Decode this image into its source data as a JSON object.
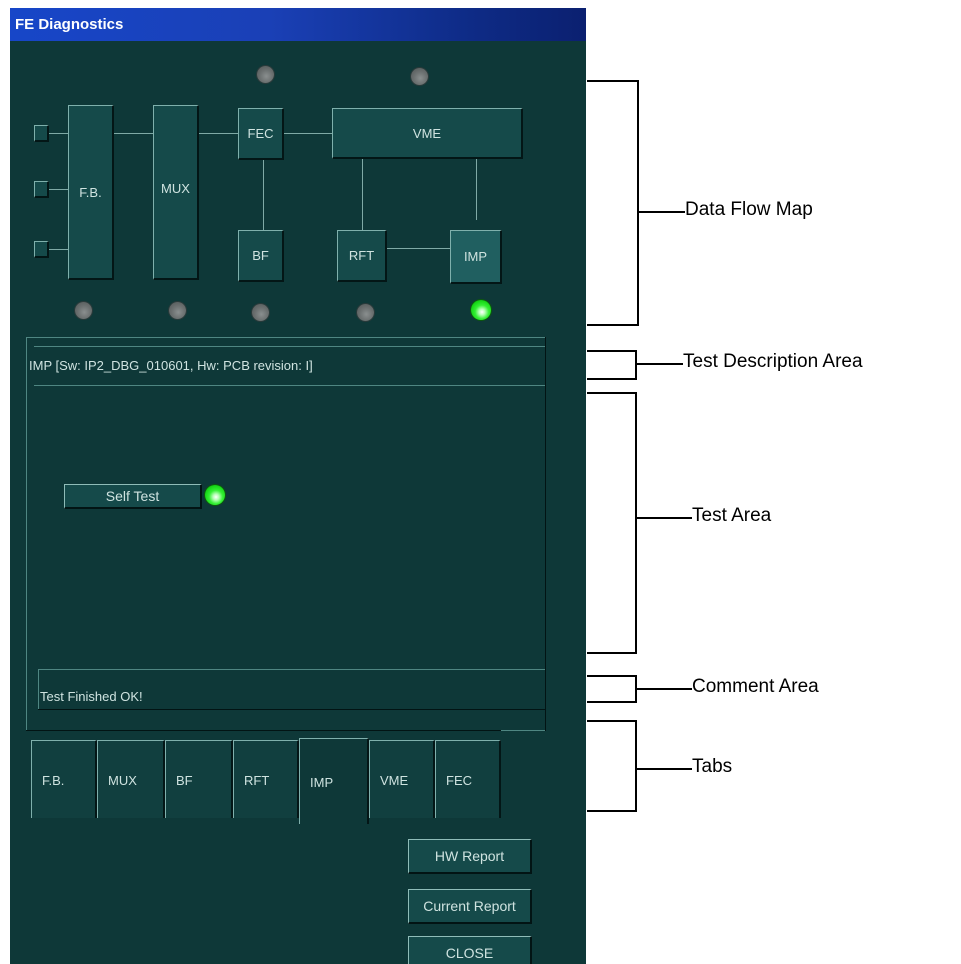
{
  "window": {
    "title": "FE Diagnostics"
  },
  "flow_map": {
    "nodes": {
      "fb": "F.B.",
      "mux": "MUX",
      "fec": "FEC",
      "vme": "VME",
      "bf": "BF",
      "rft": "RFT",
      "imp": "IMP"
    },
    "status_leds": [
      {
        "name": "fec",
        "state": "off"
      },
      {
        "name": "vme",
        "state": "off"
      },
      {
        "name": "fb",
        "state": "off"
      },
      {
        "name": "mux",
        "state": "off"
      },
      {
        "name": "bf",
        "state": "off"
      },
      {
        "name": "rft",
        "state": "off"
      },
      {
        "name": "imp",
        "state": "ok"
      }
    ]
  },
  "description": "IMP [Sw: IP2_DBG_010601, Hw: PCB revision: I]",
  "test_area": {
    "self_test_label": "Self Test",
    "self_test_state": "ok"
  },
  "comment": "Test Finished OK!",
  "tabs": [
    {
      "label": "F.B.",
      "active": false
    },
    {
      "label": "MUX",
      "active": false
    },
    {
      "label": "BF",
      "active": false
    },
    {
      "label": "RFT",
      "active": false
    },
    {
      "label": "IMP",
      "active": true
    },
    {
      "label": "VME",
      "active": false
    },
    {
      "label": "FEC",
      "active": false
    }
  ],
  "buttons": {
    "hw_report": "HW Report",
    "current_report": "Current Report",
    "close": "CLOSE"
  },
  "annotations": {
    "data_flow_map": "Data Flow Map",
    "test_description_area": "Test Description Area",
    "test_area": "Test Area",
    "comment_area": "Comment Area",
    "tabs": "Tabs"
  },
  "colors": {
    "window_bg": "#0e3838",
    "led_ok": "#22e622",
    "led_off": "#6c7171"
  }
}
